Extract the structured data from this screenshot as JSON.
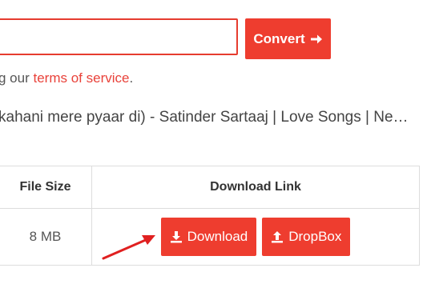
{
  "form": {
    "input_value": "",
    "convert_label": "Convert",
    "convert_icon": "arrow-right-icon",
    "terms_prefix": "g our ",
    "terms_link": "terms of service",
    "terms_suffix": "."
  },
  "video": {
    "title": "kahani mere pyaar di) - Satinder Sartaaj | Love Songs | New Punjabi Songs"
  },
  "table": {
    "headers": [
      "File Size",
      "Download Link"
    ],
    "rows": [
      {
        "size": "8 MB",
        "download_label": "Download",
        "download_icon": "download-icon",
        "dropbox_label": "DropBox",
        "dropbox_icon": "upload-icon"
      }
    ]
  },
  "annotation": {
    "arrow_color": "#e02020"
  },
  "colors": {
    "accent": "#ee3d2f",
    "border": "#dddddd",
    "link": "#e9423a"
  }
}
